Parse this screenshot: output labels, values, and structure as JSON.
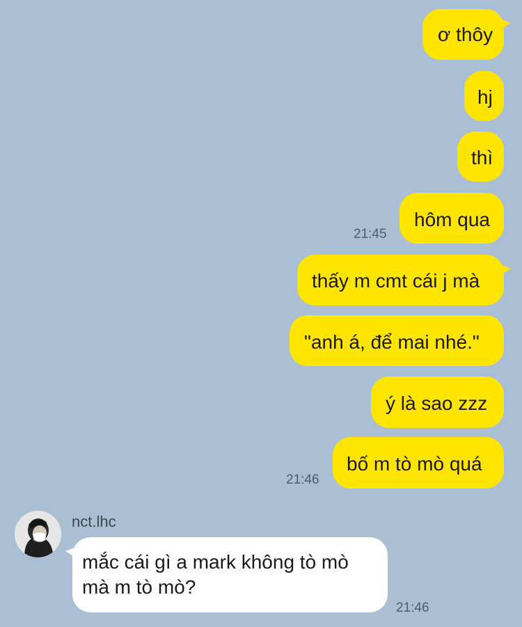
{
  "chat": {
    "outgoing": [
      {
        "text": "ơ thôy"
      },
      {
        "text": "hj"
      },
      {
        "text": "thì"
      },
      {
        "text": "hôm qua"
      },
      {
        "text": "thấy m cmt cái j mà"
      },
      {
        "text": "\"anh á, để mai nhé.\""
      },
      {
        "text": "ý là sao zzz"
      },
      {
        "text": "bố m tò mò quá"
      }
    ],
    "timestamps": [
      "21:45",
      "21:46",
      "21:46"
    ],
    "incoming": {
      "sender": "nct.lhc",
      "avatar_icon": "profile-photo-masked-person",
      "message": "mắc cái gì a mark không tò mò mà m tò mò?"
    }
  },
  "colors": {
    "background": "#aabfd3",
    "outgoing_bubble": "#fee500",
    "incoming_bubble": "#ffffff"
  }
}
